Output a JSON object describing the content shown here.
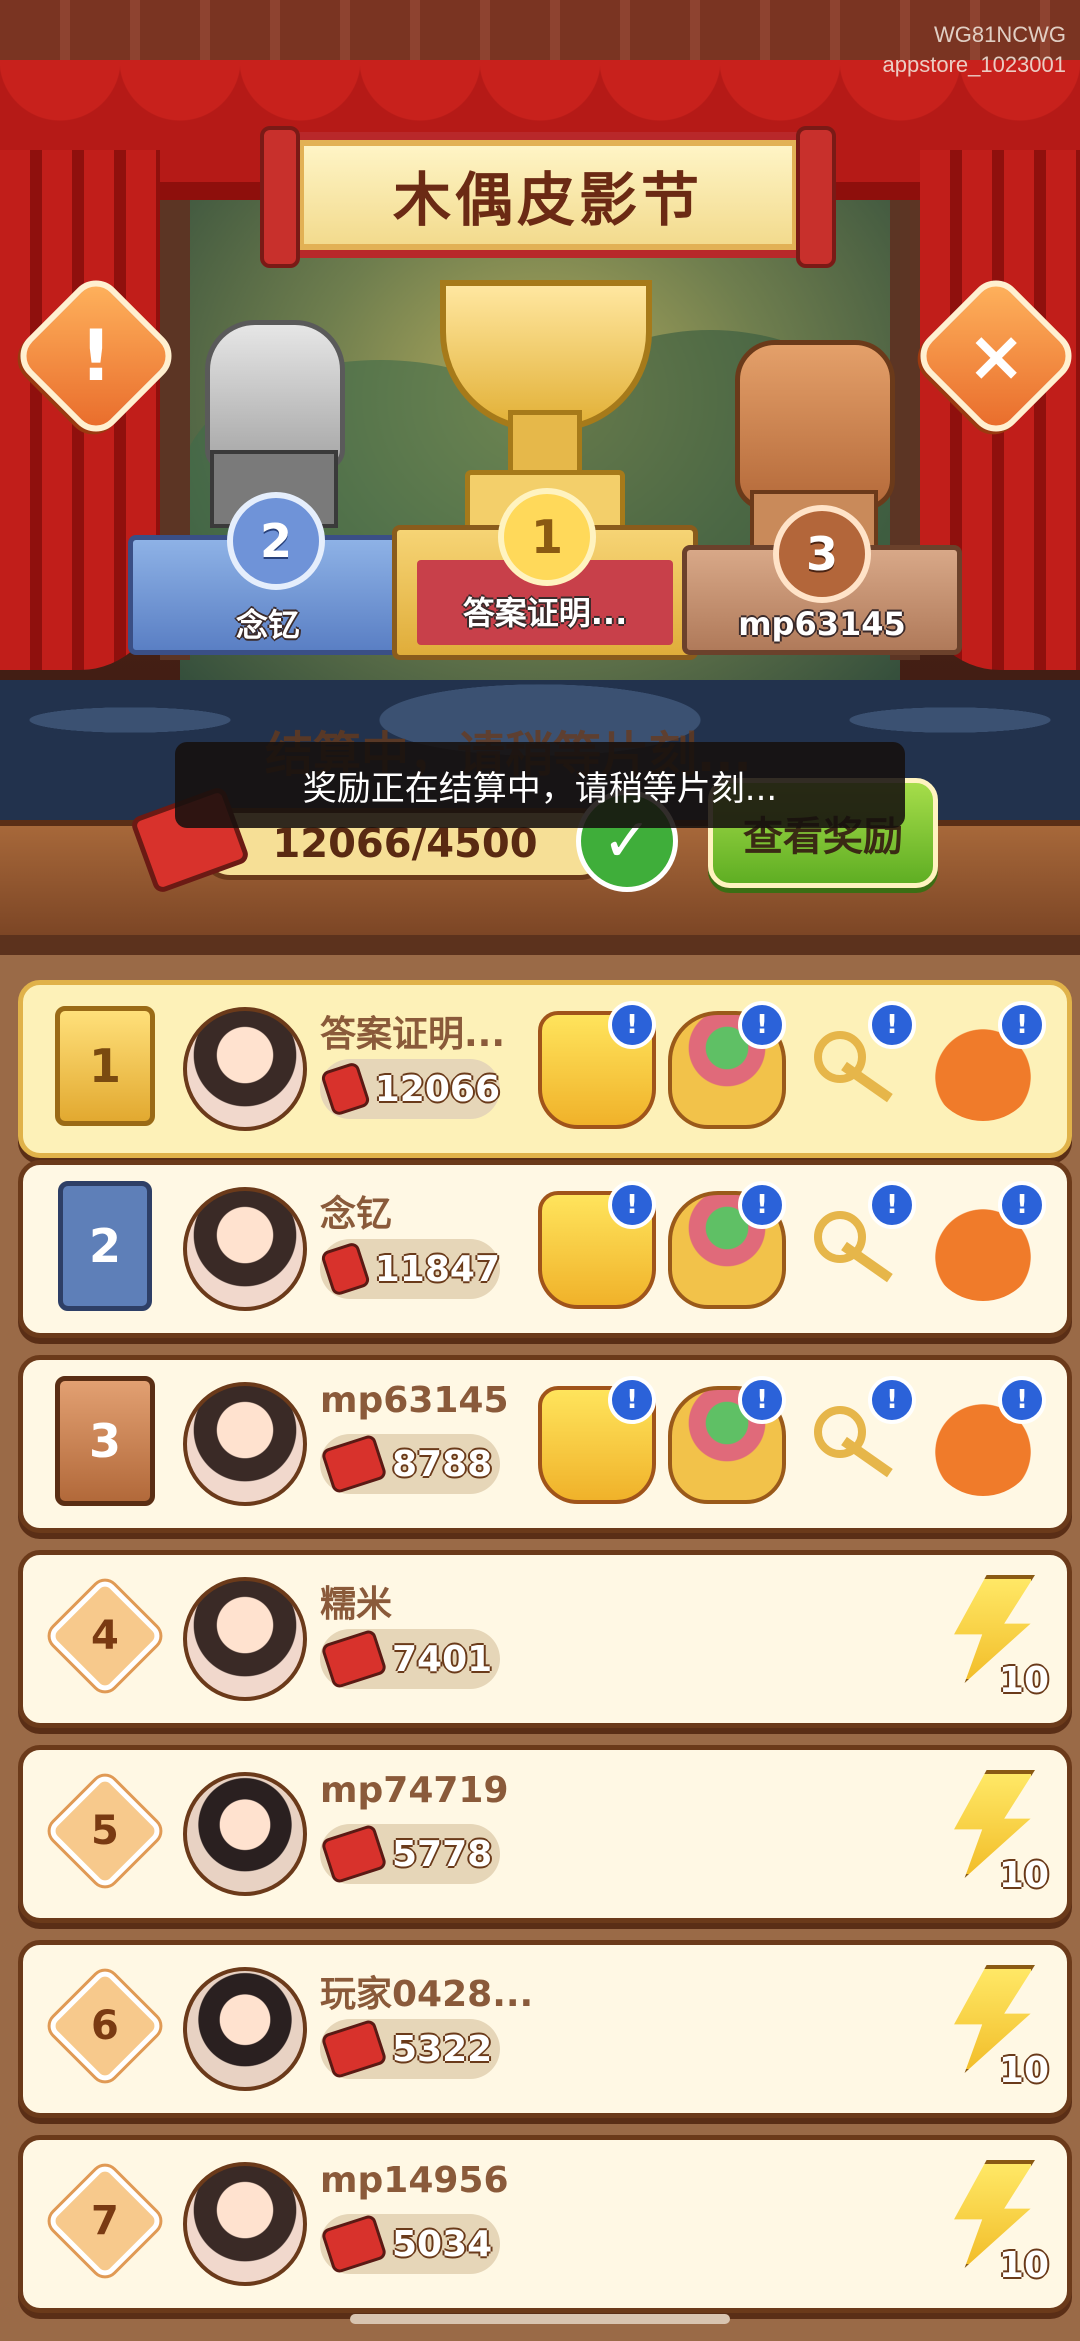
{
  "watermark": {
    "line1": "WG81NCWG",
    "line2": "appstore_1023001"
  },
  "title": "木偶皮影节",
  "buttons": {
    "info": "!",
    "close": "×",
    "view_rewards": "查看奖励"
  },
  "podium": [
    {
      "rank": "2",
      "name": "念钇"
    },
    {
      "rank": "1",
      "name": "答案证明..."
    },
    {
      "rank": "3",
      "name": "mp63145"
    }
  ],
  "settle_heading": "结算中，请稍等片刻...",
  "my_progress": "12066/4500",
  "toast": "奖励正在结算中，请稍等片刻...",
  "reward_badge": "!",
  "ranking": [
    {
      "rank": "1",
      "name": "答案证明...",
      "score": "12066",
      "rewards": [
        "bolt-bucket-icon",
        "jade-bowl-icon",
        "golden-key-icon",
        "lucky-bag-icon"
      ]
    },
    {
      "rank": "2",
      "name": "念钇",
      "score": "11847",
      "rewards": [
        "bolt-bucket-icon",
        "jewel-bowl-icon",
        "golden-key-icon",
        "lucky-bag-icon"
      ]
    },
    {
      "rank": "3",
      "name": "mp63145",
      "score": "8788",
      "rewards": [
        "bolt-bucket-icon",
        "treasure-bowl-icon",
        "golden-key-icon",
        "lucky-bag-icon"
      ]
    },
    {
      "rank": "4",
      "name": "糯米",
      "score": "7401",
      "bolt": "10"
    },
    {
      "rank": "5",
      "name": "mp74719",
      "score": "5778",
      "bolt": "10"
    },
    {
      "rank": "6",
      "name": "玩家0428...",
      "score": "5322",
      "bolt": "10"
    },
    {
      "rank": "7",
      "name": "mp14956",
      "score": "5034",
      "bolt": "10"
    }
  ]
}
